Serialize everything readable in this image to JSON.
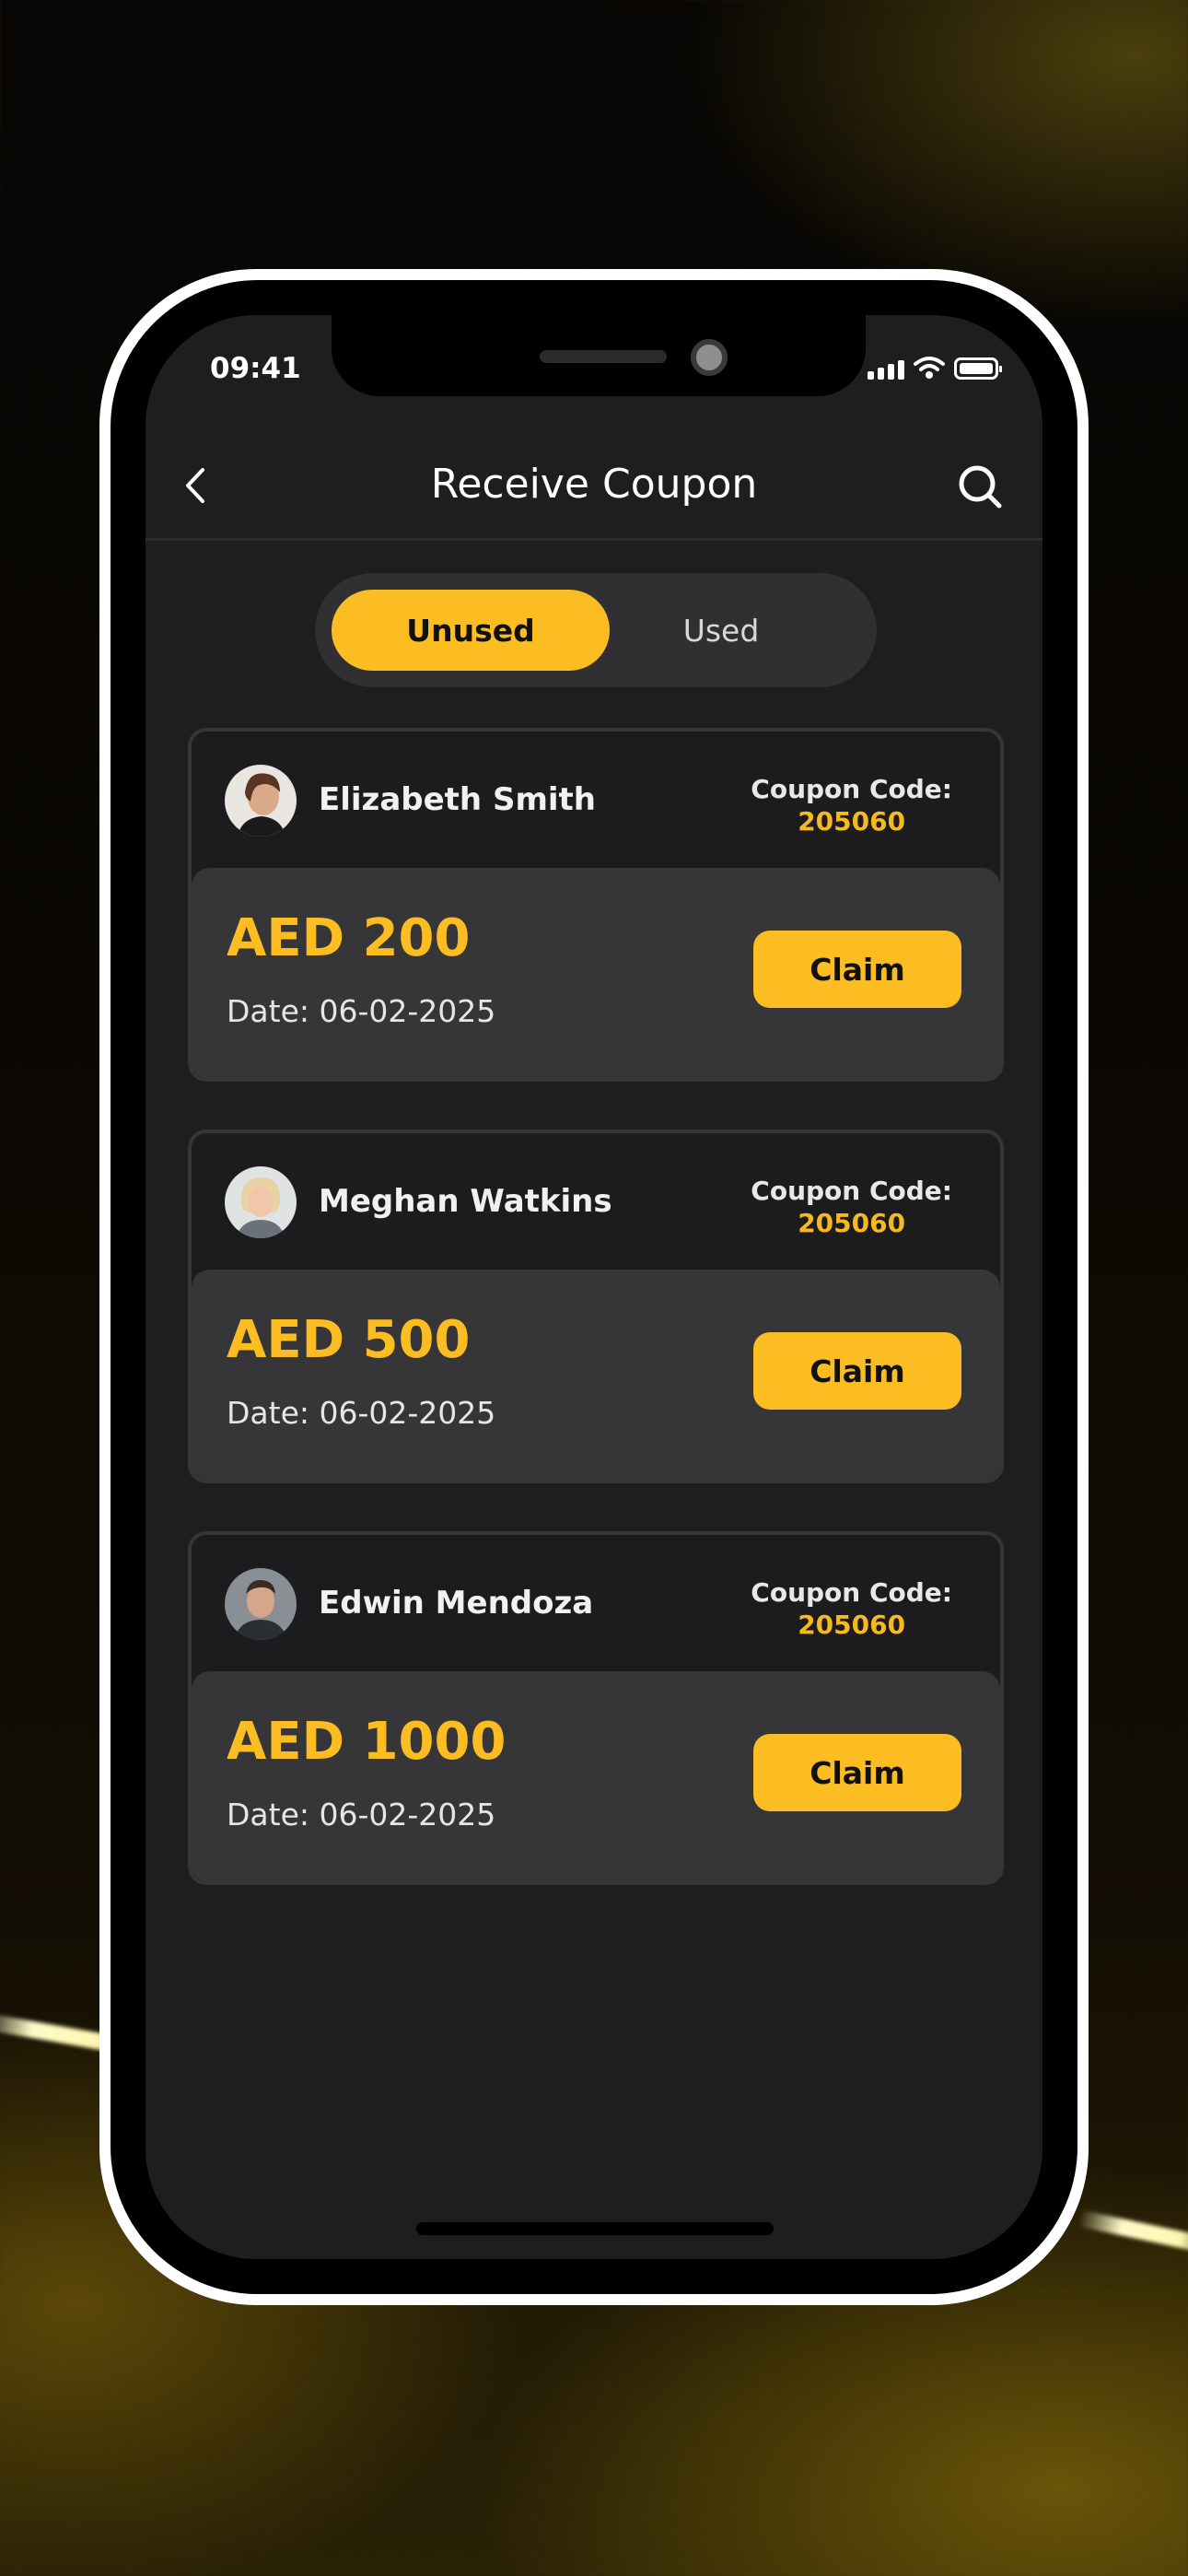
{
  "status_bar": {
    "time": "09:41"
  },
  "header": {
    "title": "Receive Coupon",
    "back_icon": "chevron-left-icon",
    "search_icon": "search-icon"
  },
  "tabs": [
    {
      "label": "Unused",
      "active": true
    },
    {
      "label": "Used",
      "active": false
    }
  ],
  "coupons": [
    {
      "name": "Elizabeth Smith",
      "code_label": "Coupon Code:",
      "code": "205060",
      "amount": "AED 200",
      "date": "Date: 06-02-2025",
      "claim_label": "Claim"
    },
    {
      "name": "Meghan Watkins",
      "code_label": "Coupon Code:",
      "code": "205060",
      "amount": "AED 500",
      "date": "Date: 06-02-2025",
      "claim_label": "Claim"
    },
    {
      "name": "Edwin Mendoza",
      "code_label": "Coupon Code:",
      "code": "205060",
      "amount": "AED 1000",
      "date": "Date: 06-02-2025",
      "claim_label": "Claim"
    }
  ],
  "colors": {
    "accent": "#fbbd22",
    "background": "#1e1e1f",
    "card_bottom": "#363638"
  }
}
